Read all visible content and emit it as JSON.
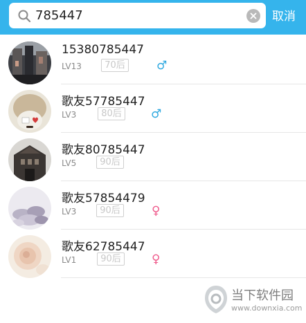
{
  "search": {
    "query": "785447",
    "cancel_label": "取消"
  },
  "results": [
    {
      "name": "15380785447",
      "level": "LV13",
      "age_tag": "70后",
      "gender": "♂",
      "gender_kind": "male"
    },
    {
      "name": "歌友57785447",
      "level": "LV3",
      "age_tag": "80后",
      "gender": "♂",
      "gender_kind": "male"
    },
    {
      "name": "歌友80785447",
      "level": "LV5",
      "age_tag": "90后",
      "gender": "",
      "gender_kind": "none"
    },
    {
      "name": "歌友57854479",
      "level": "LV3",
      "age_tag": "90后",
      "gender": "♀",
      "gender_kind": "female"
    },
    {
      "name": "歌友62785447",
      "level": "LV1",
      "age_tag": "90后",
      "gender": "♀",
      "gender_kind": "female"
    }
  ],
  "watermark": {
    "title": "当下软件园",
    "url": "www.downxia.com"
  },
  "colors": {
    "header_blue": "#35b4ec",
    "male_blue": "#2fa9e0",
    "female_pink": "#ef5b8c"
  }
}
